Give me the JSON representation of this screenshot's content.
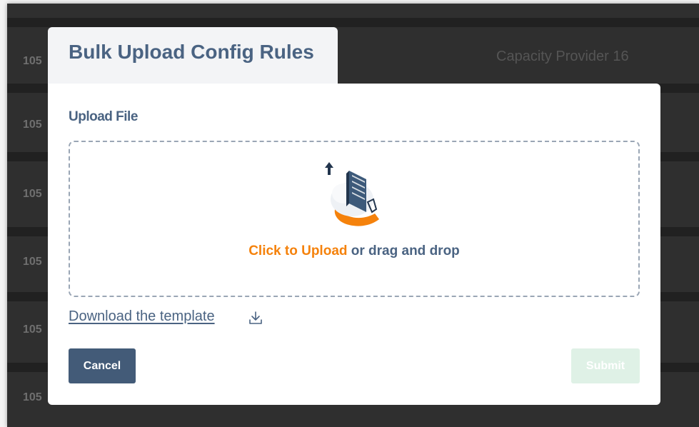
{
  "background": {
    "row_ids": [
      "105",
      "105",
      "105",
      "105",
      "105",
      "105"
    ],
    "provider_label": "Capacity Provider 16"
  },
  "modal": {
    "title": "Bulk Upload Config Rules",
    "upload_label": "Upload File",
    "dropzone": {
      "click_text": "Click to Upload",
      "rest_text": " or drag and drop",
      "icon": "cloud-upload-icon"
    },
    "download_link": "Download the template",
    "download_icon": "download-icon",
    "cancel_label": "Cancel",
    "submit_label": "Submit"
  },
  "colors": {
    "accent": "#f5820c",
    "primary": "#435b78",
    "submit_disabled": "#dff1e6",
    "title_text": "#4a6382"
  }
}
